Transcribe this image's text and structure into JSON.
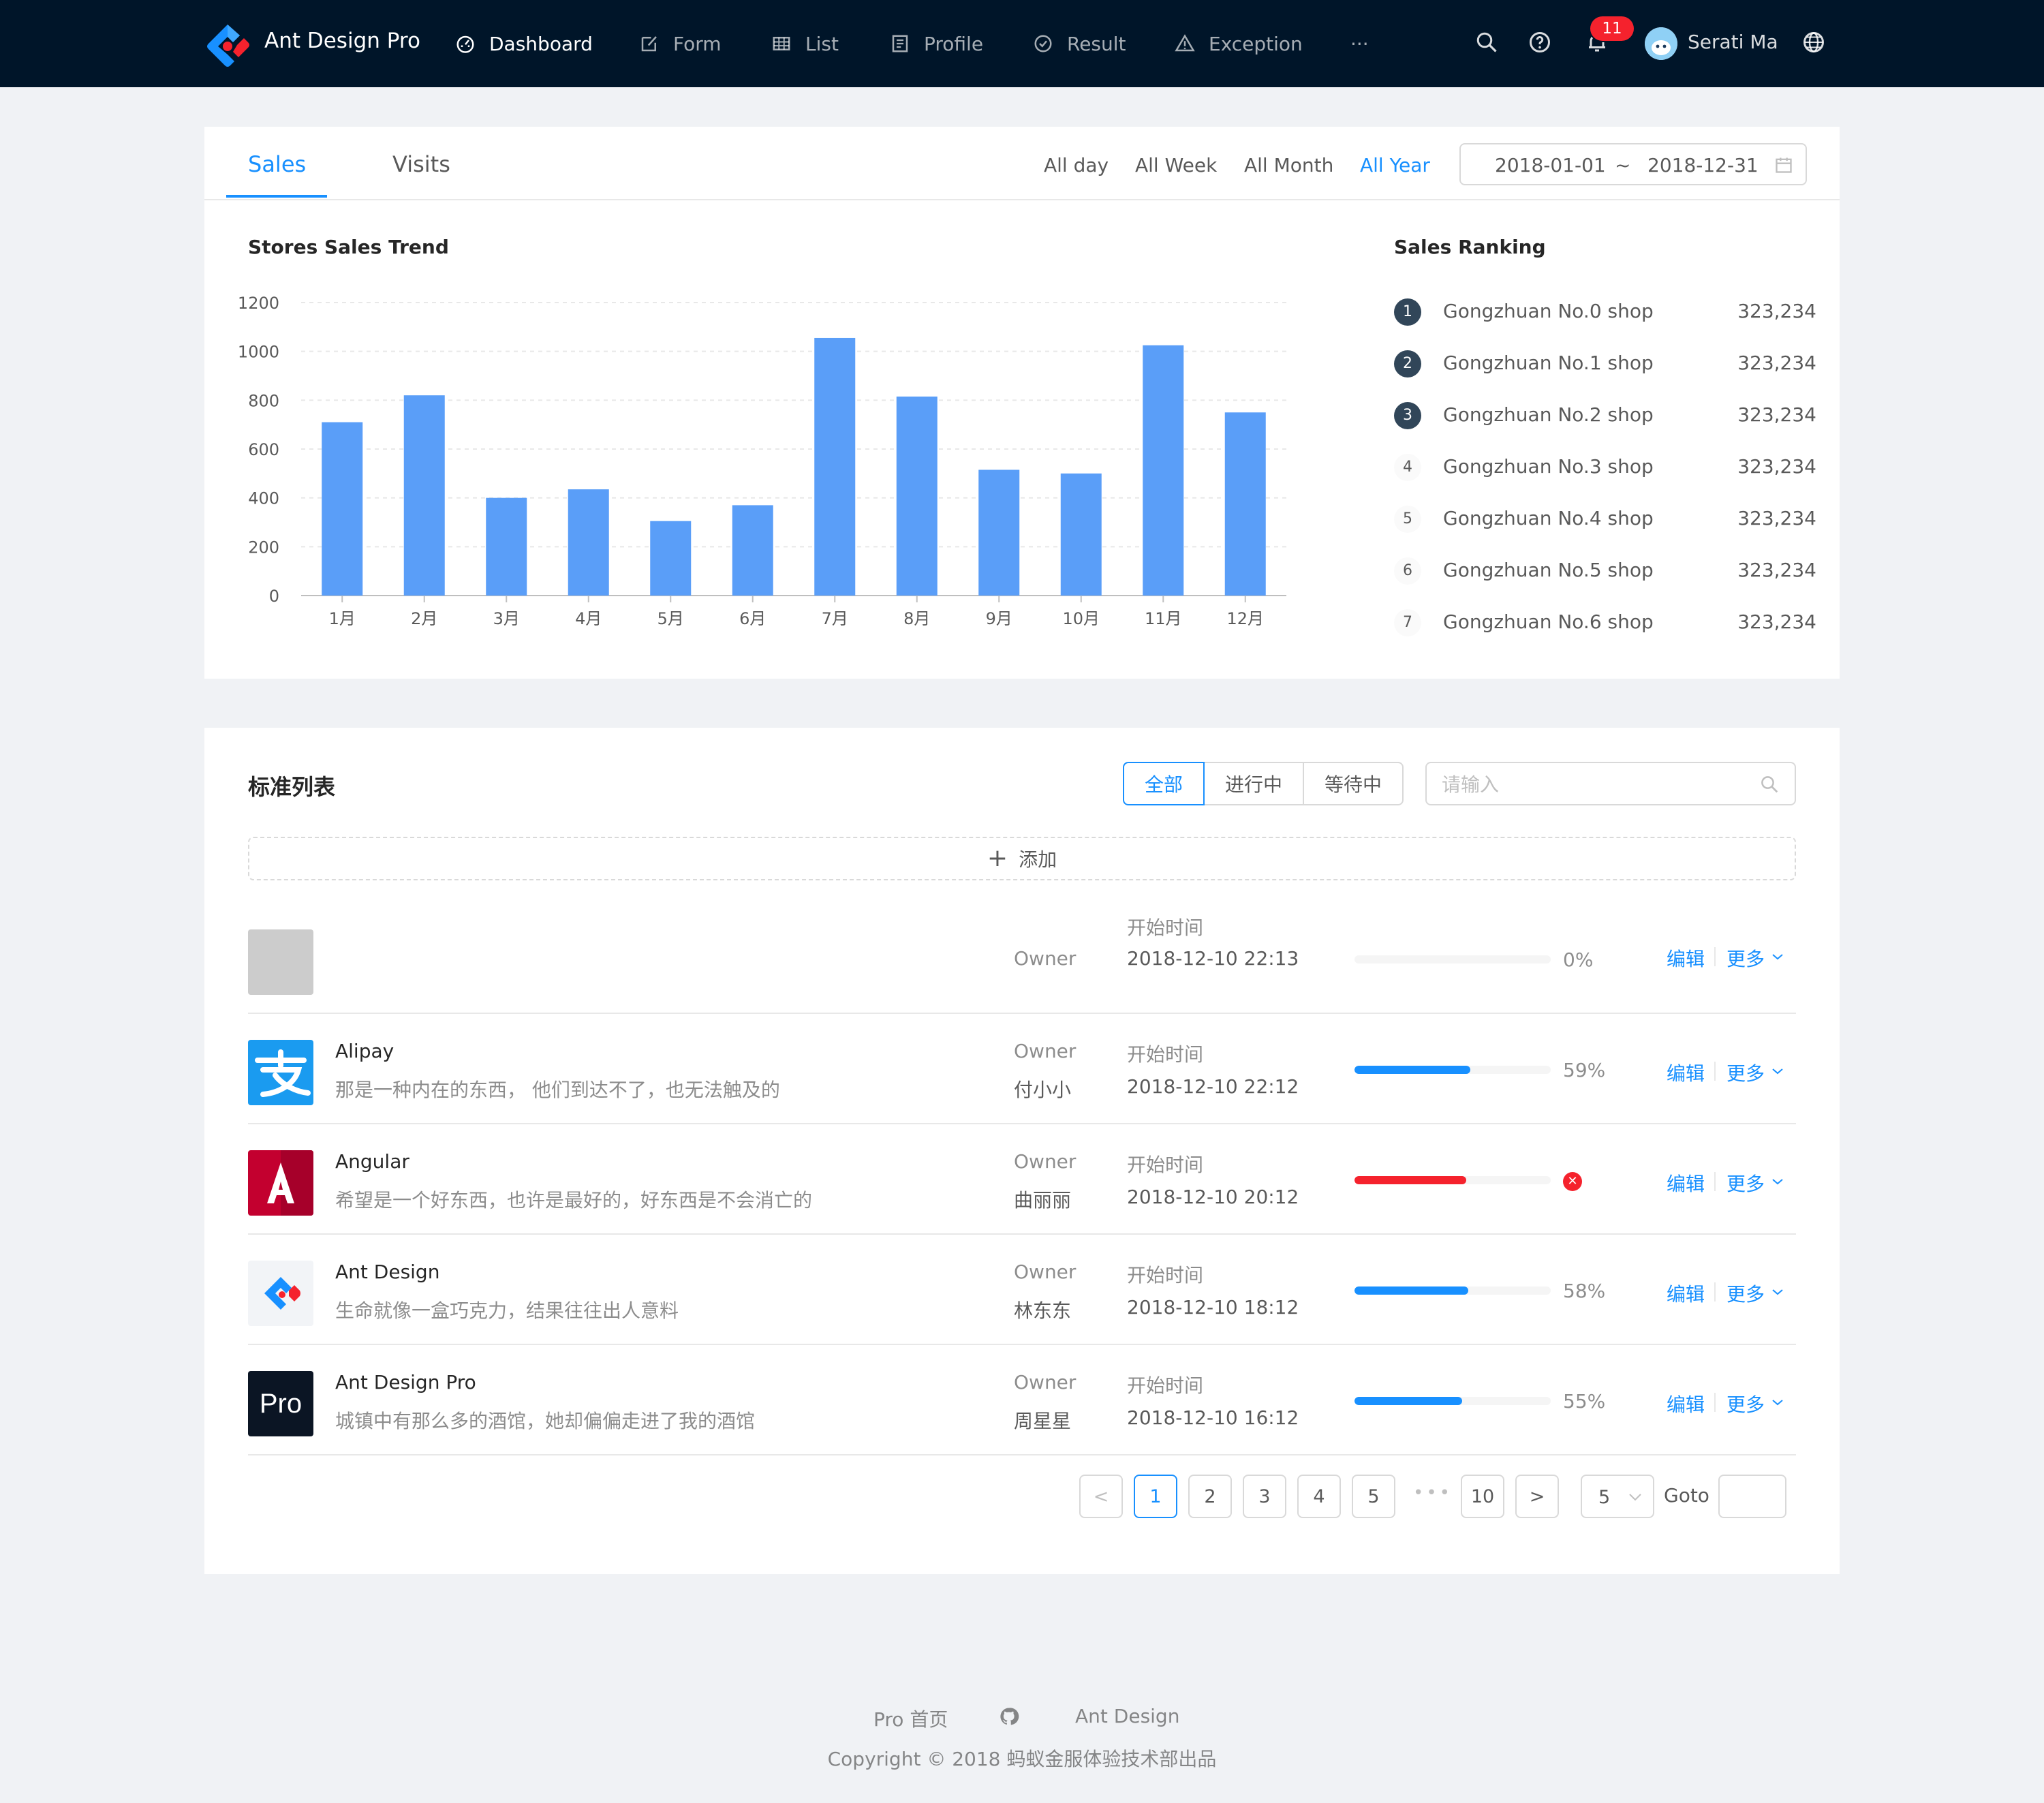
{
  "header": {
    "app_title": "Ant Design Pro",
    "nav": [
      {
        "label": "Dashboard",
        "icon": "dashboard-icon",
        "active": true
      },
      {
        "label": "Form",
        "icon": "form-icon"
      },
      {
        "label": "List",
        "icon": "table-icon"
      },
      {
        "label": "Profile",
        "icon": "profile-icon"
      },
      {
        "label": "Result",
        "icon": "check-circle-icon"
      },
      {
        "label": "Exception",
        "icon": "warning-icon"
      }
    ],
    "more_label": "···",
    "notification_count": "11",
    "user_name": "Serati Ma"
  },
  "sales_card": {
    "tabs": [
      "Sales",
      "Visits"
    ],
    "active_tab": "Sales",
    "ranges": [
      "All day",
      "All Week",
      "All Month",
      "All Year"
    ],
    "active_range": "All Year",
    "date_start": "2018-01-01",
    "date_sep": "~",
    "date_end": "2018-12-31",
    "trend_title": "Stores Sales Trend",
    "ranking_title": "Sales Ranking",
    "ranking": [
      {
        "rank": "1",
        "title": "Gongzhuan No.0 shop",
        "value": "323,234"
      },
      {
        "rank": "2",
        "title": "Gongzhuan No.1 shop",
        "value": "323,234"
      },
      {
        "rank": "3",
        "title": "Gongzhuan No.2 shop",
        "value": "323,234"
      },
      {
        "rank": "4",
        "title": "Gongzhuan No.3 shop",
        "value": "323,234"
      },
      {
        "rank": "5",
        "title": "Gongzhuan No.4 shop",
        "value": "323,234"
      },
      {
        "rank": "6",
        "title": "Gongzhuan No.5 shop",
        "value": "323,234"
      },
      {
        "rank": "7",
        "title": "Gongzhuan No.6 shop",
        "value": "323,234"
      }
    ]
  },
  "chart_data": {
    "type": "bar",
    "title": "Stores Sales Trend",
    "categories": [
      "1月",
      "2月",
      "3月",
      "4月",
      "5月",
      "6月",
      "7月",
      "8月",
      "9月",
      "10月",
      "11月",
      "12月"
    ],
    "values": [
      710,
      820,
      400,
      435,
      305,
      370,
      1055,
      815,
      515,
      500,
      1025,
      750
    ],
    "ylim": [
      0,
      1200
    ],
    "yticks": [
      0,
      200,
      400,
      600,
      800,
      1000,
      1200
    ],
    "grid": true,
    "color": "#5a9ef8"
  },
  "list_card": {
    "title": "标准列表",
    "filters": [
      "全部",
      "进行中",
      "等待中"
    ],
    "active_filter": "全部",
    "search_placeholder": "请输入",
    "add_label": "添加",
    "owner_label": "Owner",
    "start_label": "开始时间",
    "edit_label": "编辑",
    "more_label": "更多",
    "items": [
      {
        "title": "",
        "desc": "",
        "owner": "",
        "start": "2018-12-10 22:13",
        "percent": 0,
        "status": "normal",
        "percent_text": "0%",
        "logo": "placeholder"
      },
      {
        "title": "Alipay",
        "desc": "那是一种内在的东西， 他们到达不了，也无法触及的",
        "owner": "付小小",
        "start": "2018-12-10 22:12",
        "percent": 59,
        "status": "active",
        "percent_text": "59%",
        "logo": "alipay"
      },
      {
        "title": "Angular",
        "desc": "希望是一个好东西，也许是最好的，好东西是不会消亡的",
        "owner": "曲丽丽",
        "start": "2018-12-10 20:12",
        "percent": 57,
        "status": "exception",
        "percent_text": "",
        "logo": "angular"
      },
      {
        "title": "Ant Design",
        "desc": "生命就像一盒巧克力，结果往往出人意料",
        "owner": "林东东",
        "start": "2018-12-10 18:12",
        "percent": 58,
        "status": "normal",
        "percent_text": "58%",
        "logo": "antd"
      },
      {
        "title": "Ant Design Pro",
        "desc": "城镇中有那么多的酒馆，她却偏偏走进了我的酒馆",
        "owner": "周星星",
        "start": "2018-12-10 16:12",
        "percent": 55,
        "status": "active",
        "percent_text": "55%",
        "logo": "pro"
      }
    ],
    "avatar_pro_text": "Pro",
    "pagination": {
      "prev": "<",
      "next": ">",
      "pages": [
        "1",
        "2",
        "3",
        "4",
        "5"
      ],
      "current": "1",
      "ellipsis": "•••",
      "last": "10",
      "page_size": "5",
      "goto_label": "Goto"
    }
  },
  "footer": {
    "links": [
      "Pro 首页",
      "Ant Design"
    ],
    "copyright": "Copyright © 2018 蚂蚁金服体验技术部出品"
  }
}
